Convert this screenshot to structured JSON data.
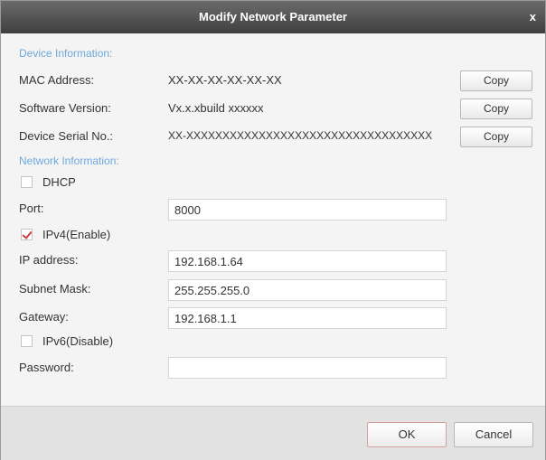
{
  "dialog": {
    "title": "Modify Network Parameter",
    "close_label": "x"
  },
  "device_info": {
    "heading": "Device Information:",
    "mac": {
      "label": "MAC Address:",
      "value": "XX-XX-XX-XX-XX-XX",
      "copy": "Copy"
    },
    "software": {
      "label": "Software Version:",
      "value": "Vx.x.xbuild xxxxxx",
      "copy": "Copy"
    },
    "serial": {
      "label": "Device Serial No.:",
      "value": "XX-XXXXXXXXXXXXXXXXXXXXXXXXXXXXXXXXXX",
      "copy": "Copy"
    }
  },
  "network_info": {
    "heading": "Network Information:",
    "dhcp": {
      "label": "DHCP",
      "checked": false
    },
    "port": {
      "label": "Port:",
      "value": "8000"
    },
    "ipv4": {
      "label": "IPv4(Enable)",
      "checked": true
    },
    "ip": {
      "label": "IP address:",
      "value": "192.168.1.64"
    },
    "subnet": {
      "label": "Subnet Mask:",
      "value": "255.255.255.0"
    },
    "gateway": {
      "label": "Gateway:",
      "value": "192.168.1.1"
    },
    "ipv6": {
      "label": "IPv6(Disable)",
      "checked": false
    },
    "password": {
      "label": "Password:",
      "value": ""
    }
  },
  "footer": {
    "ok": "OK",
    "cancel": "Cancel"
  },
  "colors": {
    "section_heading": "#6fa8dc",
    "check_mark": "#d13c3c",
    "title_bar": "#4a4a4a"
  }
}
